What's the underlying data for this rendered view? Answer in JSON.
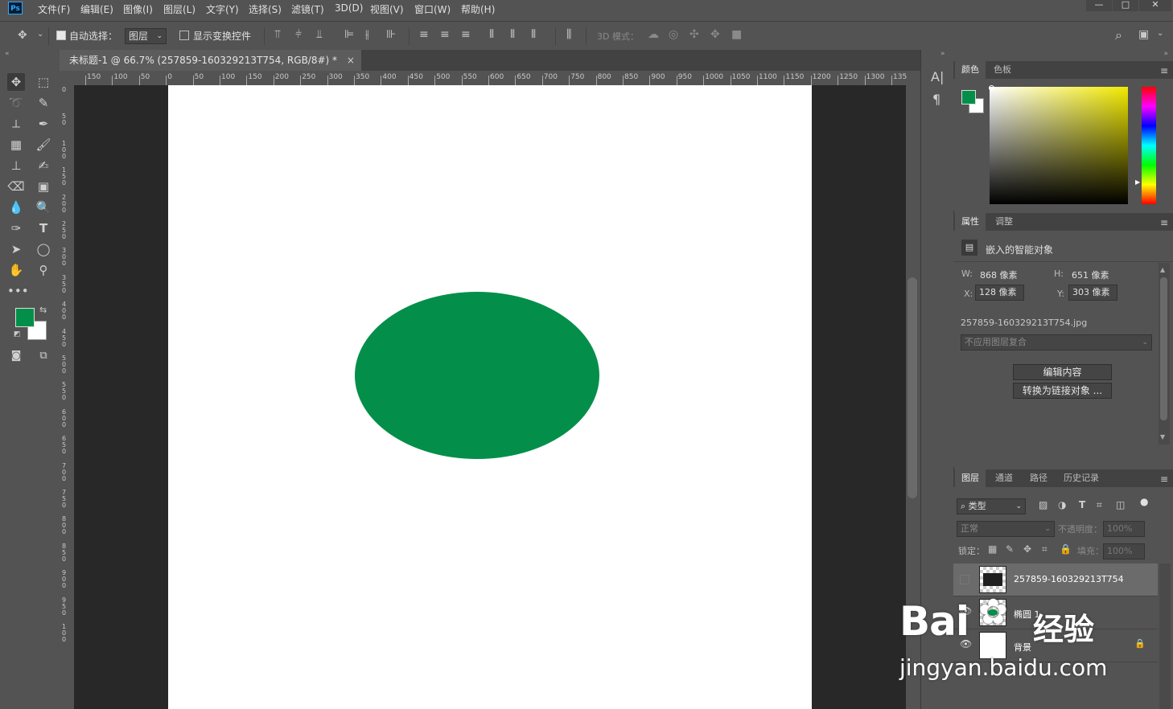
{
  "app": {
    "logo": "Ps"
  },
  "menu": [
    "文件(F)",
    "编辑(E)",
    "图像(I)",
    "图层(L)",
    "文字(Y)",
    "选择(S)",
    "滤镜(T)",
    "3D(D)",
    "视图(V)",
    "窗口(W)",
    "帮助(H)"
  ],
  "window_controls": {
    "minimize": "—",
    "maximize": "□",
    "close": "✕"
  },
  "options": {
    "auto_select_label": "自动选择：",
    "auto_select_checked": true,
    "auto_select_target": "图层",
    "show_transform_label": "显示变换控件",
    "mode_3d_label": "3D 模式："
  },
  "document": {
    "tab_title": "未标题-1 @ 66.7% (257859-160329213T754, RGB/8#) *",
    "tab_close": "×",
    "ellipse_color": "#038f49"
  },
  "ruler_top": [
    "150",
    "100",
    "50",
    "0",
    "50",
    "100",
    "150",
    "200",
    "250",
    "300",
    "350",
    "400",
    "450",
    "500",
    "550",
    "600",
    "650",
    "700",
    "750",
    "800",
    "850",
    "900",
    "950",
    "1000",
    "1050",
    "1100",
    "1150",
    "1200",
    "1250",
    "1300",
    "135"
  ],
  "ruler_left": [
    "0",
    "5\n0",
    "1\n0\n0",
    "1\n5\n0",
    "2\n0\n0",
    "2\n5\n0",
    "3\n0\n0",
    "3\n5\n0",
    "4\n0\n0",
    "4\n5\n0",
    "5\n0\n0",
    "5\n5\n0",
    "6\n0\n0",
    "6\n5\n0",
    "7\n0\n0",
    "7\n5\n0",
    "8\n0\n0",
    "8\n5\n0",
    "9\n0\n0",
    "9\n5\n0",
    "1\n0\n0"
  ],
  "colors": {
    "foreground": "#038f49",
    "background": "#ffffff"
  },
  "color_panel": {
    "tabs": [
      "颜色",
      "色板"
    ]
  },
  "properties_panel": {
    "tabs": [
      "属性",
      "调整"
    ],
    "object_type": "嵌入的智能对象",
    "w_label": "W:",
    "w_value": "868 像素",
    "h_label": "H:",
    "h_value": "651 像素",
    "x_label": "X:",
    "x_value": "128 像素",
    "y_label": "Y:",
    "y_value": "303 像素",
    "filename": "257859-160329213T754.jpg",
    "comp_placeholder": "不应用图层复合",
    "edit_contents": "编辑内容",
    "convert_linked": "转换为链接对象 ..."
  },
  "layers_panel": {
    "tabs": [
      "图层",
      "通道",
      "路径",
      "历史记录"
    ],
    "filter_kind": "类型",
    "blend_mode": "正常",
    "opacity_label": "不透明度：",
    "opacity_value": "100%",
    "lock_label": "锁定：",
    "fill_label": "填充：",
    "fill_value": "100%",
    "layers": [
      {
        "name": "257859-160329213T754",
        "visible": false,
        "selected": true
      },
      {
        "name": "椭圆 1",
        "visible": true,
        "selected": false
      },
      {
        "name": "背景",
        "visible": true,
        "selected": false,
        "locked": true
      }
    ]
  },
  "watermark": {
    "brand": "Bai",
    "paw_text": "经验",
    "url": "jingyan.baidu.com"
  }
}
